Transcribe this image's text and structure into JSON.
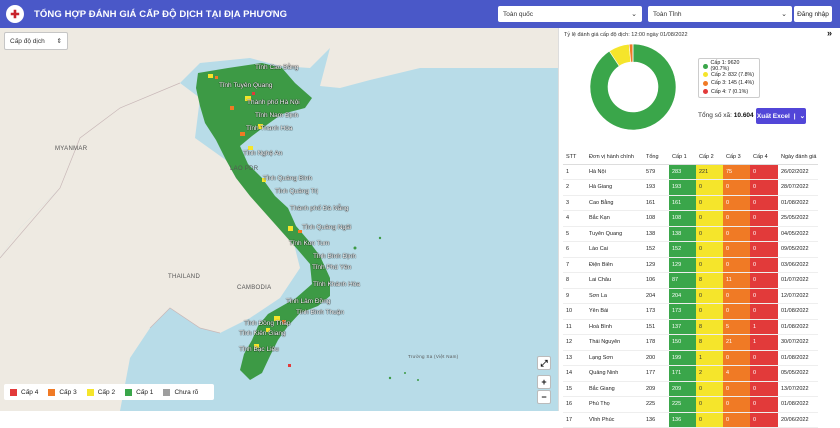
{
  "header": {
    "title": "TỔNG HỢP ĐÁNH GIÁ CẤP ĐỘ DỊCH TẠI ĐỊA PHƯƠNG",
    "scope_select": "Toàn quốc",
    "province_select": "Toàn Tỉnh",
    "login_label": "Đăng nhập"
  },
  "map": {
    "level_filter": "Cấp độ dịch",
    "country_labels": [
      "MYANMAR",
      "LAO PDR",
      "THAILAND",
      "CAMBODIA"
    ],
    "island_label": "Trường Sa (Việt Nam)",
    "province_labels": [
      "Tỉnh Cao Bằng",
      "Tỉnh Tuyên Quang",
      "Thành phố Hà Nội",
      "Tỉnh Nam Định",
      "Tỉnh Thanh Hóa",
      "Tỉnh Nghệ An",
      "Tỉnh Quảng Bình",
      "Tỉnh Quảng Trị",
      "Thành phố Đà Nẵng",
      "Tỉnh Quảng Ngãi",
      "Tỉnh Kon Tum",
      "Tỉnh Bình Định",
      "Tỉnh Phú Yên",
      "Tỉnh Khánh Hòa",
      "Tỉnh Lâm Đồng",
      "Tỉnh Bình Thuận",
      "Tỉnh Đồng Tháp",
      "Tỉnh Kiên Giang",
      "Tỉnh Bạc Liêu"
    ],
    "legend": [
      {
        "label": "Cấp 4",
        "color": "#e23a3a"
      },
      {
        "label": "Cấp 3",
        "color": "#f07a25"
      },
      {
        "label": "Cấp 2",
        "color": "#f5e52b"
      },
      {
        "label": "Cấp 1",
        "color": "#3aa64a"
      },
      {
        "label": "Chưa rõ",
        "color": "#9e9e9e"
      }
    ],
    "fullscreen_icon": "expand-icon",
    "zoom_in": "+",
    "zoom_out": "−"
  },
  "panel": {
    "rate_title": "Tỷ lệ đánh giá cấp độ dịch: 12:00 ngày 01/08/2022",
    "pie_legend": [
      {
        "label": "Cấp 1: 9620 (90.7%)",
        "color": "#3aa64a"
      },
      {
        "label": "Cấp 2: 832 (7.8%)",
        "color": "#f5e52b"
      },
      {
        "label": "Cấp 3: 145 (1.4%)",
        "color": "#f07a25"
      },
      {
        "label": "Cấp 4: 7 (0.1%)",
        "color": "#e23a3a"
      }
    ],
    "total_label": "Tổng số xã:",
    "total_value": "10.604",
    "excel_label": "Xuất Excel",
    "table": {
      "headers": [
        "STT",
        "Đơn vị hành chính",
        "Tổng",
        "Cấp 1",
        "Cấp 2",
        "Cấp 3",
        "Cấp 4",
        "Ngày đánh giá"
      ],
      "rows": [
        [
          "1",
          "Hà Nội",
          "579",
          "283",
          "221",
          "75",
          "0",
          "26/02/2022"
        ],
        [
          "2",
          "Hà Giang",
          "193",
          "193",
          "0",
          "0",
          "0",
          "28/07/2022"
        ],
        [
          "3",
          "Cao Bằng",
          "161",
          "161",
          "0",
          "0",
          "0",
          "01/08/2022"
        ],
        [
          "4",
          "Bắc Kạn",
          "108",
          "108",
          "0",
          "0",
          "0",
          "25/05/2022"
        ],
        [
          "5",
          "Tuyên Quang",
          "138",
          "138",
          "0",
          "0",
          "0",
          "04/05/2022"
        ],
        [
          "6",
          "Lào Cai",
          "152",
          "152",
          "0",
          "0",
          "0",
          "09/05/2022"
        ],
        [
          "7",
          "Điện Biên",
          "129",
          "129",
          "0",
          "0",
          "0",
          "03/06/2022"
        ],
        [
          "8",
          "Lai Châu",
          "106",
          "87",
          "8",
          "11",
          "0",
          "01/07/2022"
        ],
        [
          "9",
          "Sơn La",
          "204",
          "204",
          "0",
          "0",
          "0",
          "12/07/2022"
        ],
        [
          "10",
          "Yên Bái",
          "173",
          "173",
          "0",
          "0",
          "0",
          "01/08/2022"
        ],
        [
          "11",
          "Hoà Bình",
          "151",
          "137",
          "8",
          "5",
          "1",
          "01/08/2022"
        ],
        [
          "12",
          "Thái Nguyên",
          "178",
          "150",
          "8",
          "21",
          "1",
          "30/07/2022"
        ],
        [
          "13",
          "Lạng Sơn",
          "200",
          "199",
          "1",
          "0",
          "0",
          "01/08/2022"
        ],
        [
          "14",
          "Quảng Ninh",
          "177",
          "171",
          "2",
          "4",
          "0",
          "05/05/2022"
        ],
        [
          "15",
          "Bắc Giang",
          "209",
          "209",
          "0",
          "0",
          "0",
          "13/07/2022"
        ],
        [
          "16",
          "Phú Thọ",
          "225",
          "225",
          "0",
          "0",
          "0",
          "01/08/2022"
        ],
        [
          "17",
          "Vĩnh Phúc",
          "136",
          "136",
          "0",
          "0",
          "0",
          "20/06/2022"
        ]
      ]
    }
  },
  "chart_data": {
    "type": "pie",
    "categories": [
      "Cấp 1",
      "Cấp 2",
      "Cấp 3",
      "Cấp 4"
    ],
    "values": [
      9620,
      832,
      145,
      7
    ],
    "colors": [
      "#3aa64a",
      "#f5e52b",
      "#f07a25",
      "#e23a3a"
    ]
  }
}
